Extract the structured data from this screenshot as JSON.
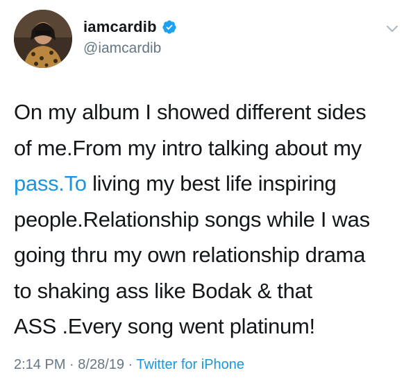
{
  "user": {
    "display_name": "iamcardib",
    "handle": "@iamcardib",
    "verified_icon": "verified-badge-icon",
    "avatar_icon": "avatar"
  },
  "menu": {
    "icon": "chevron-down-icon"
  },
  "tweet": {
    "line1": "On my album I showed different sides",
    "line2": "of me.From my intro talking about my",
    "line3_link": "pass.To",
    "line3_rest": " living my best life inspiring",
    "line4": "people.Relationship songs while I was",
    "line5": "going thru my own relationship drama",
    "line6": "to shaking ass like Bodak & that",
    "line7": "ASS .Every song went platinum!"
  },
  "meta": {
    "time": "2:14 PM",
    "sep1": " · ",
    "date": "8/28/19",
    "sep2": " · ",
    "source": "Twitter for iPhone"
  },
  "colors": {
    "link": "#1b95e0",
    "verified": "#1da1f2",
    "muted": "#657786",
    "text": "#14171a"
  }
}
